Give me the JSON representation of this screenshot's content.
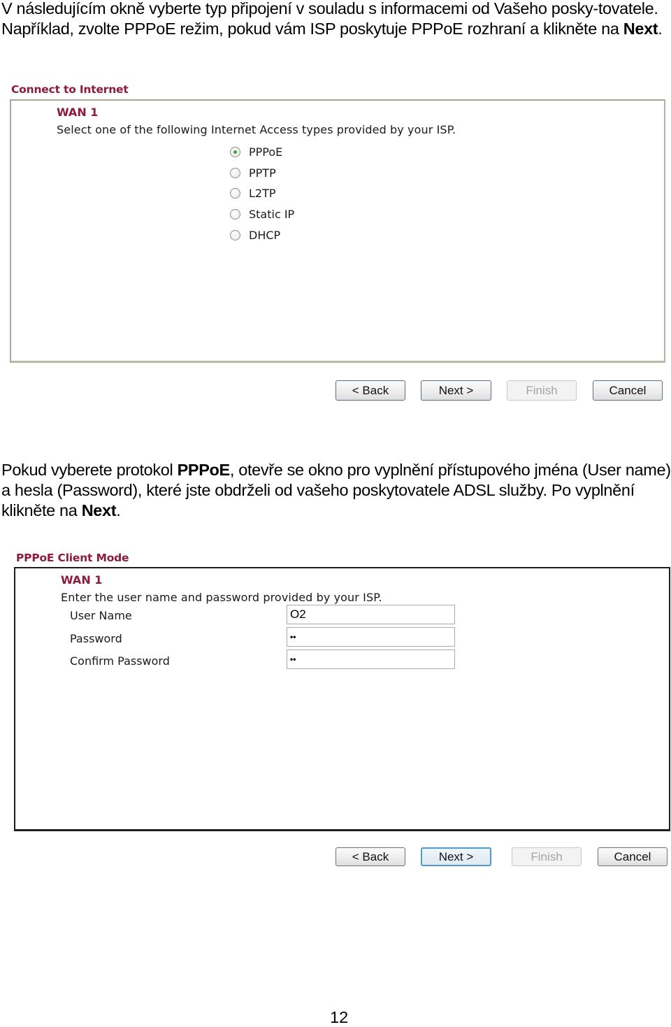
{
  "intro": {
    "text_before": "V následujícím okně vyberte typ připojení v souladu s informacemi od Vašeho posky-tovatele. Například, zvolte PPPoE režim, pokud vám ISP poskytuje PPPoE rozhraní a klikněte na ",
    "bold": "Next",
    "text_after": "."
  },
  "connect_panel": {
    "title": "Connect to Internet",
    "wan_label": "WAN 1",
    "instruction": "Select one of the following Internet Access types provided by your ISP.",
    "options": [
      {
        "label": "PPPoE",
        "checked": true
      },
      {
        "label": "PPTP",
        "checked": false
      },
      {
        "label": "L2TP",
        "checked": false
      },
      {
        "label": "Static IP",
        "checked": false
      },
      {
        "label": "DHCP",
        "checked": false
      }
    ],
    "buttons": {
      "back": "< Back",
      "next": "Next >",
      "finish": "Finish",
      "cancel": "Cancel"
    }
  },
  "middle": {
    "part1": "Pokud vyberete protokol ",
    "bold1": "PPPoE",
    "part2": ", otevře se okno pro vyplnění přístupového jména (User name) a hesla (Password), které jste obdrželi od vašeho poskytovatele ADSL služby. Po vyplnění klikněte na ",
    "bold2": "Next",
    "part3": "."
  },
  "pppoe_panel": {
    "title": "PPPoE Client Mode",
    "wan_label": "WAN 1",
    "instruction": "Enter the user name and password provided by your ISP.",
    "fields": {
      "user_name": {
        "label": "User Name",
        "value": "O2"
      },
      "password": {
        "label": "Password",
        "value": "••"
      },
      "confirm_password": {
        "label": "Confirm Password",
        "value": "••"
      }
    },
    "buttons": {
      "back": "< Back",
      "next": "Next >",
      "finish": "Finish",
      "cancel": "Cancel"
    }
  },
  "page_number": "12",
  "colors": {
    "section_title": "#8b1c3b",
    "radio_selected": "#32a543",
    "focused_button_border": "#4f9bc9"
  }
}
